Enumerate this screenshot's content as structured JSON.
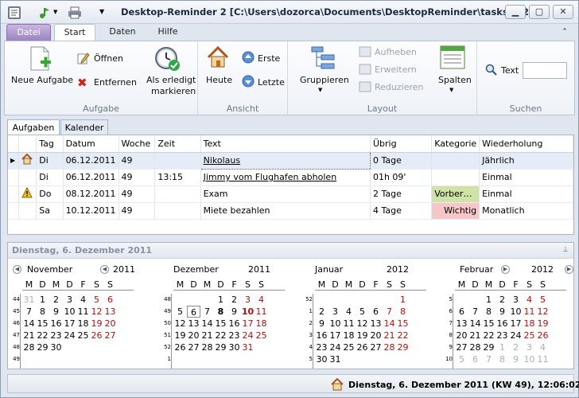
{
  "app": {
    "title": "Desktop-Reminder 2 [C:\\Users\\dozorca\\Documents\\DesktopReminder\\tasks.dr2]"
  },
  "ribbon": {
    "tabs": [
      "Datei",
      "Start",
      "Daten",
      "Hilfe"
    ],
    "groups": {
      "aufgabe": "Aufgabe",
      "ansicht": "Ansicht",
      "layout": "Layout",
      "suchen": "Suchen"
    },
    "neue_aufgabe": "Neue Aufgabe",
    "oeffnen": "Öffnen",
    "entfernen": "Entfernen",
    "erledigt1": "Als erledigt",
    "erledigt2": "markieren",
    "heute": "Heute",
    "erste": "Erste",
    "letzte": "Letzte",
    "gruppieren": "Gruppieren",
    "aufheben": "Aufheben",
    "erweitern": "Erweitern",
    "reduzieren": "Reduzieren",
    "spalten": "Spalten",
    "text": "Text",
    "search_value": ""
  },
  "views": {
    "tabs": [
      "Aufgaben",
      "Kalender"
    ]
  },
  "table": {
    "columns": [
      "Tag",
      "Datum",
      "Woche",
      "Zeit",
      "Text",
      "Übrig",
      "Kategorie",
      "Wiederholung"
    ],
    "rows": [
      {
        "tag": "Di",
        "datum": "06.12.2011",
        "woche": "49",
        "zeit": "",
        "text": "Nikolaus",
        "uebrig": "0 Tage",
        "kategorie": "",
        "wdh": "Jährlich",
        "icon": "house-icon"
      },
      {
        "tag": "Di",
        "datum": "06.12.2011",
        "woche": "49",
        "zeit": "13:15",
        "text": "Jimmy vom Flughafen abholen",
        "uebrig": "01h 09'",
        "kategorie": "",
        "wdh": "Einmal",
        "icon": ""
      },
      {
        "tag": "Do",
        "datum": "08.12.2011",
        "woche": "49",
        "zeit": "",
        "text": "Exam",
        "uebrig": "2 Tage",
        "kategorie": "Vorber…",
        "wdh": "Einmal",
        "icon": "warning-icon"
      },
      {
        "tag": "Sa",
        "datum": "10.12.2011",
        "woche": "49",
        "zeit": "",
        "text": "Miete bezahlen",
        "uebrig": "4 Tage",
        "kategorie": "Wichtig",
        "wdh": "Monatlich",
        "icon": ""
      }
    ]
  },
  "calendar": {
    "header": "Dienstag, 6. Dezember 2011",
    "dows": [
      "M",
      "D",
      "M",
      "D",
      "F",
      "S",
      "S"
    ],
    "months": [
      {
        "name": "November",
        "year": "2011",
        "weeks": [
          "44",
          "45",
          "46",
          "47",
          "48",
          "49"
        ],
        "days": [
          [
            "31",
            "1",
            "2",
            "3",
            "4",
            "5",
            "6"
          ],
          [
            "7",
            "8",
            "9",
            "10",
            "11",
            "12",
            "13"
          ],
          [
            "14",
            "15",
            "16",
            "17",
            "18",
            "19",
            "20"
          ],
          [
            "21",
            "22",
            "23",
            "24",
            "25",
            "26",
            "27"
          ],
          [
            "28",
            "29",
            "30",
            "",
            "",
            "",
            ""
          ]
        ]
      },
      {
        "name": "Dezember",
        "year": "2011",
        "weeks": [
          "48",
          "49",
          "50",
          "51",
          "52",
          "1"
        ],
        "days": [
          [
            "",
            "",
            "",
            "1",
            "2",
            "3",
            "4"
          ],
          [
            "5",
            "6",
            "7",
            "8",
            "9",
            "10",
            "11"
          ],
          [
            "12",
            "13",
            "14",
            "15",
            "16",
            "17",
            "18"
          ],
          [
            "19",
            "20",
            "21",
            "22",
            "23",
            "24",
            "25"
          ],
          [
            "26",
            "27",
            "28",
            "29",
            "30",
            "31",
            ""
          ]
        ]
      },
      {
        "name": "Januar",
        "year": "2012",
        "weeks": [
          "52",
          "1",
          "2",
          "3",
          "4",
          "5"
        ],
        "days": [
          [
            "",
            "",
            "",
            "",
            "",
            "",
            "1"
          ],
          [
            "2",
            "3",
            "4",
            "5",
            "6",
            "7",
            "8"
          ],
          [
            "9",
            "10",
            "11",
            "12",
            "13",
            "14",
            "15"
          ],
          [
            "16",
            "17",
            "18",
            "19",
            "20",
            "21",
            "22"
          ],
          [
            "23",
            "24",
            "25",
            "26",
            "27",
            "28",
            "29"
          ],
          [
            "30",
            "31",
            "",
            "",
            "",
            "",
            ""
          ]
        ]
      },
      {
        "name": "Februar",
        "year": "2012",
        "weeks": [
          "5",
          "6",
          "7",
          "8",
          "9",
          "10"
        ],
        "days": [
          [
            "",
            "",
            "1",
            "2",
            "3",
            "4",
            "5"
          ],
          [
            "6",
            "7",
            "8",
            "9",
            "10",
            "11",
            "12"
          ],
          [
            "13",
            "14",
            "15",
            "16",
            "17",
            "18",
            "19"
          ],
          [
            "20",
            "21",
            "22",
            "23",
            "24",
            "25",
            "26"
          ],
          [
            "27",
            "28",
            "29",
            "1",
            "2",
            "3",
            "4"
          ],
          [
            "5",
            "6",
            "7",
            "8",
            "9",
            "10",
            "11"
          ]
        ]
      }
    ]
  },
  "status": {
    "text": "Dienstag, 6. Dezember 2011 (KW 49), 12:06:02"
  }
}
